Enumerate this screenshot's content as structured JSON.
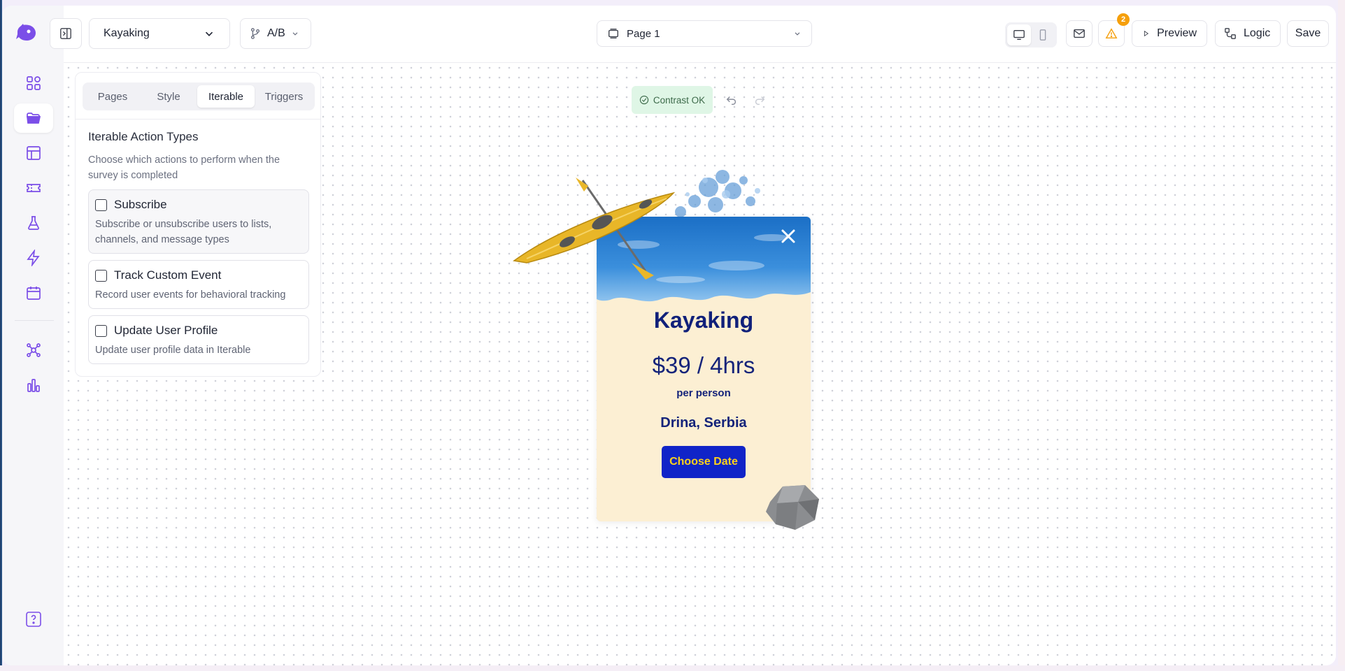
{
  "toolbar": {
    "survey_name": "Kayaking",
    "ab_label": "A/B",
    "page_select": "Page 1",
    "warnings_count": "2",
    "preview_label": "Preview",
    "logic_label": "Logic",
    "save_label": "Save"
  },
  "panel": {
    "tabs": [
      {
        "label": "Pages"
      },
      {
        "label": "Style"
      },
      {
        "label": "Iterable"
      },
      {
        "label": "Triggers"
      }
    ],
    "active_tab": "Iterable",
    "title": "Iterable Action Types",
    "description": "Choose which actions to perform when the survey is completed",
    "options": [
      {
        "title": "Subscribe",
        "description": "Subscribe or unsubscribe users to lists, channels, and message types",
        "checked": false
      },
      {
        "title": "Track Custom Event",
        "description": "Record user events for behavioral tracking",
        "checked": false
      },
      {
        "title": "Update User Profile",
        "description": "Update user profile data in Iterable",
        "checked": false
      }
    ]
  },
  "canvas": {
    "contrast_label": "Contrast OK"
  },
  "card": {
    "title": "Kayaking",
    "price": "$39 / 4hrs",
    "price_sub": "per person",
    "location": "Drina, Serbia",
    "cta_label": "Choose Date"
  },
  "colors": {
    "brand": "#7b4ee8",
    "card_background": "#fcefd3",
    "card_text": "#14237a",
    "cta_background": "#1024c8",
    "cta_text": "#ffd21a",
    "warning": "#f59f0b",
    "contrast_ok_bg": "#dff6e6"
  },
  "icons": {
    "sidebar": [
      "dashboard-icon",
      "folder-icon",
      "layout-icon",
      "ticket-icon",
      "flask-icon",
      "lightning-icon",
      "calendar-icon",
      "integrations-icon",
      "analytics-icon"
    ],
    "help": "help-icon"
  }
}
